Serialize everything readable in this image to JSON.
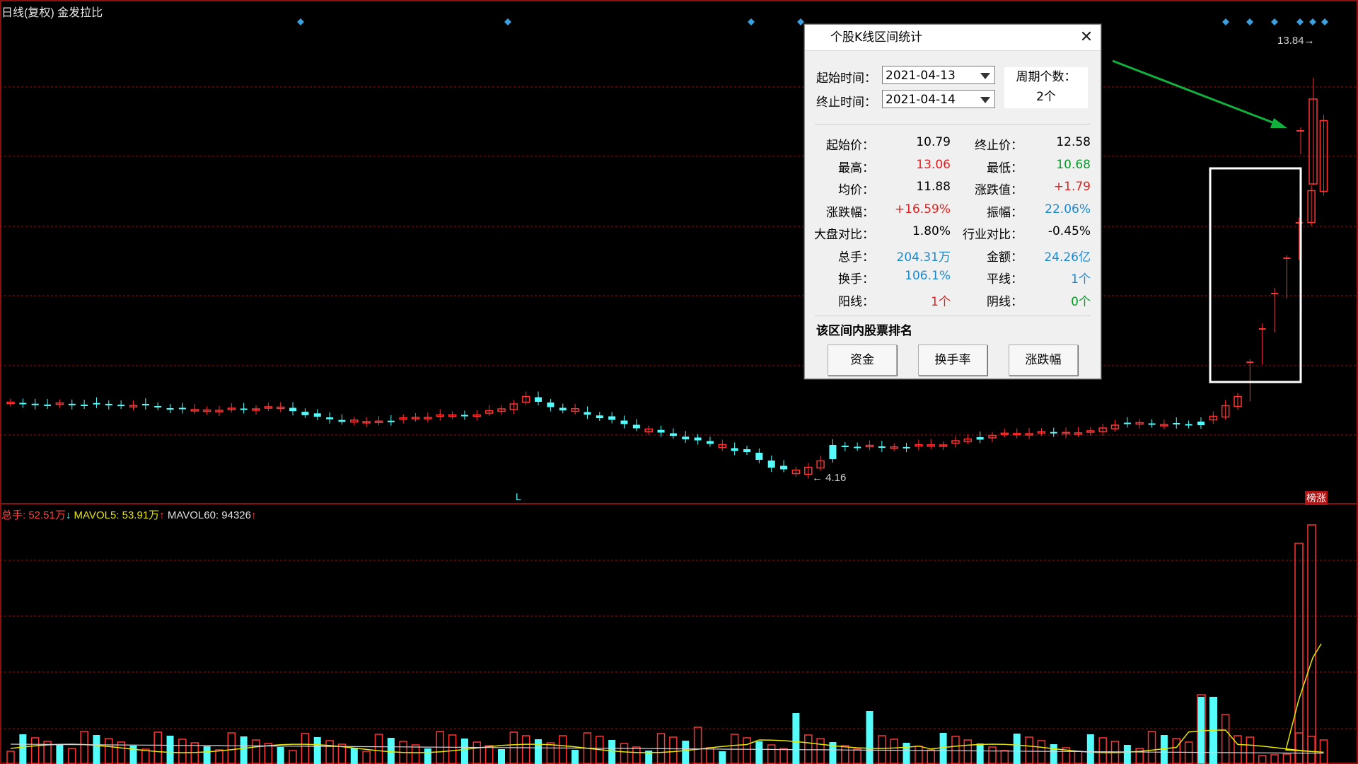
{
  "header": {
    "title": "日线(复权)",
    "stock_name": "金发拉比"
  },
  "price_labels": {
    "max_price": "13.84",
    "min_price": "4.16",
    "low_marker": "L",
    "side_badge": "榜涨"
  },
  "volume_header": {
    "total_label": "总手: 52.51万",
    "total_arrow": "↓",
    "mavol5_label": "MAVOL5: 53.91万",
    "mavol5_arrow": "↑",
    "mavol60_label": "MAVOL60: 94326",
    "mavol60_arrow": "↑"
  },
  "colors": {
    "up": "#ff3232",
    "down": "#54fcfc",
    "grid": "#8c1010",
    "ma5": "#e6e600",
    "ma60": "#d8d8d8",
    "arrow": "#12b13e",
    "marker": "#3aa0e0"
  },
  "dialog": {
    "title": "个股K线区间统计",
    "close_icon": "close-icon",
    "start_label": "起始时间：",
    "start_value": "2021-04-13",
    "end_label": "终止时间：",
    "end_value": "2021-04-14",
    "period_label": "周期个数：",
    "period_value": "2个",
    "stats": [
      {
        "k1": "起始价：",
        "v1": "10.79",
        "c1": "#000",
        "k2": "终止价：",
        "v2": "12.58",
        "c2": "#000"
      },
      {
        "k1": "最高：",
        "v1": "13.06",
        "c1": "#e02020",
        "k2": "最低：",
        "v2": "10.68",
        "c2": "#0a9a2a"
      },
      {
        "k1": "均价：",
        "v1": "11.88",
        "c1": "#000",
        "k2": "涨跌值：",
        "v2": "+1.79",
        "c2": "#e02020"
      },
      {
        "k1": "涨跌幅：",
        "v1": "+16.59%",
        "c1": "#e02020",
        "k2": "振幅：",
        "v2": "22.06%",
        "c2": "#1a8ad0"
      },
      {
        "k1": "大盘对比：",
        "v1": "1.80%",
        "c1": "#000",
        "k2": "行业对比：",
        "v2": "-0.45%",
        "c2": "#000"
      },
      {
        "k1": "总手：",
        "v1": "204.31万",
        "c1": "#1a8ad0",
        "k2": "金额：",
        "v2": "24.26亿",
        "c2": "#1a8ad0"
      },
      {
        "k1": "换手：",
        "v1": "106.1%",
        "c1": "#1a8ad0",
        "k2": "平线：",
        "v2": "1个",
        "c2": "#1a8ad0"
      },
      {
        "k1": "阳线：",
        "v1": "1个",
        "c1": "#e02020",
        "k2": "阴线：",
        "v2": "0个",
        "c2": "#0a9a2a"
      }
    ],
    "ranking_label": "该区间内股票排名",
    "buttons": [
      "资金",
      "换手率",
      "涨跌幅"
    ]
  }
}
